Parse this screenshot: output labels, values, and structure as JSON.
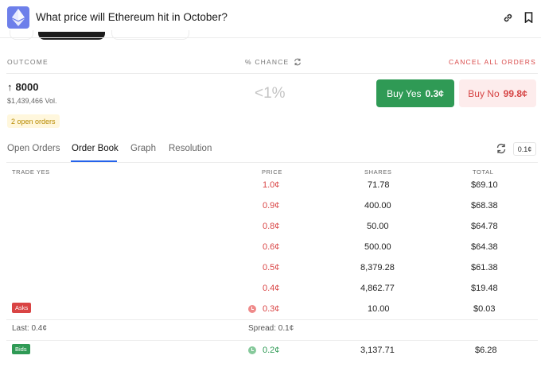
{
  "header": {
    "title": "What price will Ethereum hit in October?"
  },
  "market": {
    "column_outcome": "OUTCOME",
    "column_chance": "% CHANCE",
    "cancel_all": "CANCEL ALL ORDERS",
    "outcome_arrow": "↑",
    "outcome_value": "8000",
    "volume": "$1,439,466 Vol.",
    "chance": "<1%",
    "buy_yes_label": "Buy Yes",
    "buy_yes_price": "0.3¢",
    "buy_no_label": "Buy No",
    "buy_no_price": "99.8¢",
    "open_orders": "2 open orders"
  },
  "tabs": {
    "open_orders": "Open Orders",
    "order_book": "Order Book",
    "graph": "Graph",
    "resolution": "Resolution",
    "tick": "0.1¢"
  },
  "orderbook": {
    "headers": {
      "trade": "TRADE YES",
      "price": "PRICE",
      "shares": "SHARES",
      "total": "TOTAL"
    },
    "asks": [
      {
        "price": "1.0¢",
        "shares": "71.78",
        "total": "$69.10"
      },
      {
        "price": "0.9¢",
        "shares": "400.00",
        "total": "$68.38"
      },
      {
        "price": "0.8¢",
        "shares": "50.00",
        "total": "$64.78"
      },
      {
        "price": "0.6¢",
        "shares": "500.00",
        "total": "$64.38"
      },
      {
        "price": "0.5¢",
        "shares": "8,379.28",
        "total": "$61.38"
      },
      {
        "price": "0.4¢",
        "shares": "4,862.77",
        "total": "$19.48"
      },
      {
        "price": "0.3¢",
        "shares": "10.00",
        "total": "$0.03"
      }
    ],
    "asks_label": "Asks",
    "bids_label": "Bids",
    "last": "Last: 0.4¢",
    "spread": "Spread: 0.1¢",
    "bids": [
      {
        "price": "0.2¢",
        "shares": "3,137.71",
        "total": "$6.28"
      }
    ]
  },
  "colors": {
    "yes_green": "#2f9a55",
    "no_red": "#d94444",
    "accent_blue": "#2563eb",
    "logo_purple": "#6d7fea"
  },
  "icons": {
    "logo": "ethereum-icon",
    "link": "link-icon",
    "bookmark": "bookmark-icon",
    "sync": "sync-icon",
    "refresh": "refresh-icon",
    "clock": "clock-icon"
  }
}
